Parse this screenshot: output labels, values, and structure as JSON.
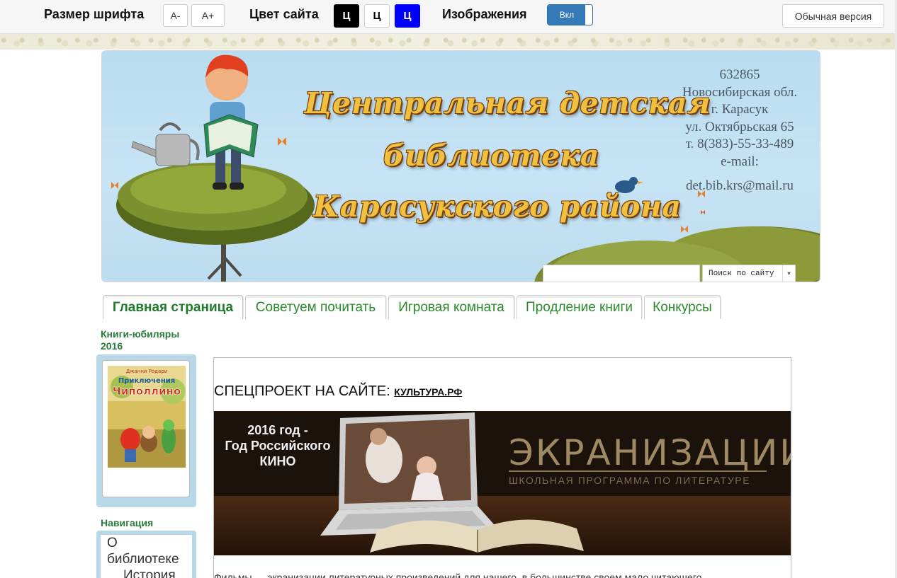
{
  "toolbar": {
    "font_size_label": "Размер шрифта",
    "font_smaller": "A-",
    "font_larger": "A+",
    "site_color_label": "Цвет сайта",
    "color_options": [
      {
        "label": "Ц",
        "bg": "#000000",
        "fg": "#ffffff"
      },
      {
        "label": "Ц",
        "bg": "#ffffff",
        "fg": "#000000"
      },
      {
        "label": "Ц",
        "bg": "#0000ff",
        "fg": "#ffffff"
      }
    ],
    "images_label": "Изображения",
    "images_toggle": "Вкл",
    "normal_version": "Обычная версия"
  },
  "header": {
    "title_lines": [
      "Центральная детская",
      "библиотека",
      "Карасукского района"
    ],
    "contact": {
      "postcode": "632865",
      "region": "Новосибирская обл.",
      "city": "г. Карасук",
      "street": "ул. Октябрьская 65",
      "phone": "т. 8(383)-55-33-489",
      "email_label": "e-mail:",
      "email": "det.bib.krs@mail.ru"
    },
    "search_button": "Поиск по сайту"
  },
  "tabs": [
    {
      "label": "Главная страница",
      "active": true
    },
    {
      "label": "Советуем почитать",
      "active": false
    },
    {
      "label": "Игровая комната",
      "active": false
    },
    {
      "label": "Продление книги",
      "active": false
    },
    {
      "label": "Конкурсы",
      "active": false
    }
  ],
  "sidebar": {
    "books_heading_line1": "Книги-юбиляры",
    "books_heading_line2": "2016",
    "book_cover": {
      "author": "Джанни Родари",
      "title_line1": "Приключения",
      "title_line2": "Чиполлино"
    },
    "nav_heading": "Навигация",
    "nav_items": [
      {
        "label": "О"
      },
      {
        "label": "библиотеке"
      },
      {
        "label": "История"
      }
    ]
  },
  "content": {
    "special_prefix": "СПЕЦПРОЕКТ НА САЙТЕ: ",
    "special_link": "КУЛЬТУРА.РФ",
    "promo": {
      "year_line1": "2016 год -",
      "year_line2": "Год Российского",
      "year_line3": "КИНО",
      "title": "ЭКРАНИЗАЦИИ",
      "subtitle": "ШКОЛЬНАЯ ПРОГРАММА ПО ЛИТЕРАТУРЕ"
    },
    "body_text": "Фильмы — экранизации литературных произведений для нашего, в большинстве своем мало читающего"
  },
  "colors": {
    "accent_green": "#2a8a2a",
    "toggle_blue": "#337ab7",
    "sky": "#c7e4f5",
    "sidebar_frame": "#b8d8ea"
  }
}
